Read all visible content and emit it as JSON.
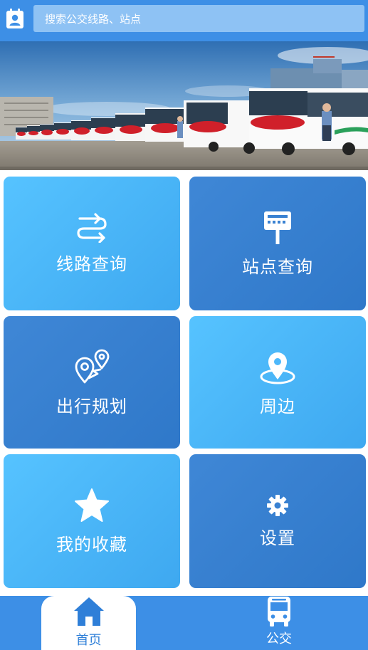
{
  "header": {
    "profile_icon": "contact-card-icon",
    "search_placeholder": "搜索公交线路、站点"
  },
  "banner": {
    "description_icon": "banner-photo",
    "dots": 4,
    "active_dot": 1
  },
  "tiles": [
    {
      "label": "线路查询",
      "icon": "route-icon"
    },
    {
      "label": "站点查询",
      "icon": "bus-stop-sign-icon"
    },
    {
      "label": "出行规划",
      "icon": "trip-plan-pin-icon"
    },
    {
      "label": "周边",
      "icon": "location-pin-icon"
    },
    {
      "label": "我的收藏",
      "icon": "star-icon"
    },
    {
      "label": "设置",
      "icon": "gear-icon"
    }
  ],
  "nav": {
    "home_label": "首页",
    "bus_label": "公交"
  },
  "colors": {
    "primary": "#3d8fe6",
    "tile_light": "#4db8fb",
    "tile_dark": "#3a82d2"
  }
}
